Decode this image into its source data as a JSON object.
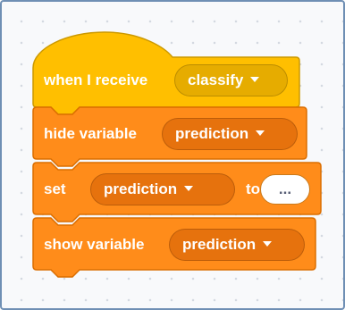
{
  "colors": {
    "event": "#ffbf00",
    "event_border": "#cc9900",
    "variable": "#ff8c1a",
    "variable_border": "#db6e00",
    "workspace_border": "#6f8fb4"
  },
  "blocks": {
    "when_receive": {
      "label": "when I receive",
      "message": "classify"
    },
    "hide_variable": {
      "label": "hide variable",
      "variable": "prediction"
    },
    "set_variable": {
      "label_set": "set",
      "variable": "prediction",
      "label_to": "to",
      "value": "..."
    },
    "show_variable": {
      "label": "show variable",
      "variable": "prediction"
    }
  }
}
